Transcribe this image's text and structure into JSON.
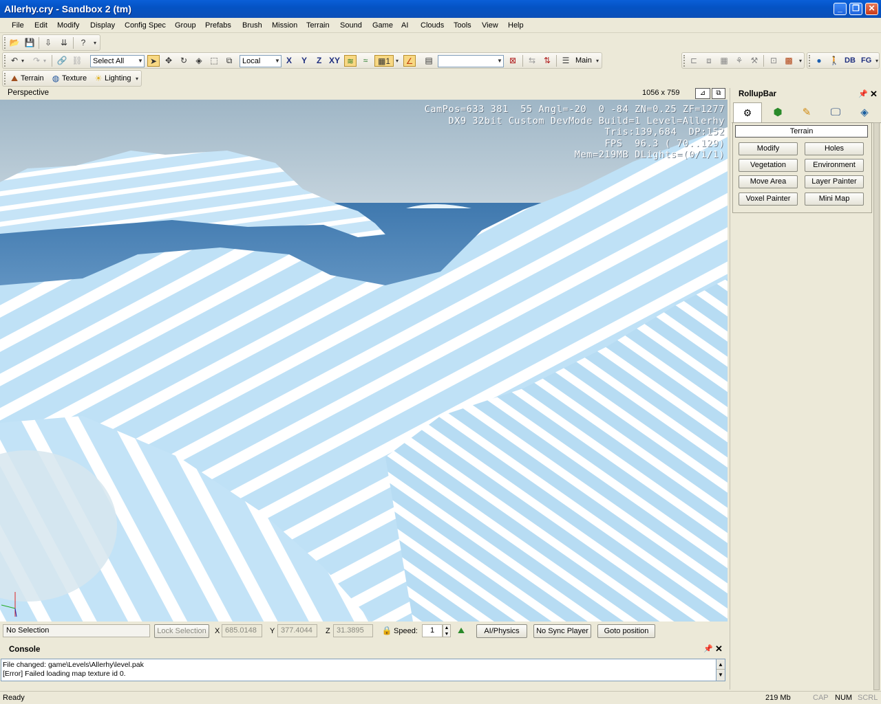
{
  "window": {
    "title": "Allerhy.cry - Sandbox 2 (tm)"
  },
  "menu": [
    "File",
    "Edit",
    "Modify",
    "Display",
    "Config Spec",
    "Group",
    "Prefabs",
    "Brush",
    "Mission",
    "Terrain",
    "Sound",
    "Game",
    "AI",
    "Clouds",
    "Tools",
    "View",
    "Help"
  ],
  "toolbar": {
    "selection_filter": "Select All",
    "ref_coord": "Local",
    "axis_x": "X",
    "axis_y": "Y",
    "axis_z": "Z",
    "axis_xy": "XY",
    "snap_value": "1",
    "layer_label": "Main",
    "db_label": "DB",
    "fg_label": "FG"
  },
  "toolbar3": {
    "terrain": "Terrain",
    "texture": "Texture",
    "lighting": "Lighting"
  },
  "viewport": {
    "name": "Perspective",
    "resolution": "1056 x 759",
    "hud": {
      "line1": "CamPos=633 381  55 Angl=-20  0 -84 ZN=0.25 ZF=1277",
      "line2": "DX9 32bit Custom DevMode Build=1 Level=Allerhy",
      "line3": "Tris:139,684  DP:152",
      "line4": "FPS  96.3 ( 70..129)",
      "line5": "Mem=219MB DLights=(0/1/1)"
    }
  },
  "rollup": {
    "title": "RollupBar",
    "section": "Terrain",
    "buttons": [
      "Modify",
      "Holes",
      "Vegetation",
      "Environment",
      "Move Area",
      "Layer Painter",
      "Voxel Painter",
      "Mini Map"
    ]
  },
  "status": {
    "selection": "No Selection",
    "lock_selection": "Lock Selection",
    "x_label": "X",
    "x_value": "685.0148",
    "y_label": "Y",
    "y_value": "377.4044",
    "z_label": "Z",
    "z_value": "31.3895",
    "speed_label": "Speed:",
    "speed_value": "1",
    "ai_physics": "AI/Physics",
    "no_sync_player": "No Sync Player",
    "goto_position": "Goto position"
  },
  "console": {
    "title": "Console",
    "lines": [
      "File changed: game\\Levels\\Allerhy\\level.pak",
      "[Error] Failed loading map texture id 0."
    ]
  },
  "bottom": {
    "ready": "Ready",
    "memory": "219 Mb",
    "cap": "CAP",
    "num": "NUM",
    "scrl": "SCRL"
  },
  "colors": {
    "titlebar": "#0a5fd8",
    "sky": "#a5b8c6",
    "water": "#4a7fb0",
    "terrain_light": "#b9dcf2",
    "hud_text": "#ffffff"
  }
}
